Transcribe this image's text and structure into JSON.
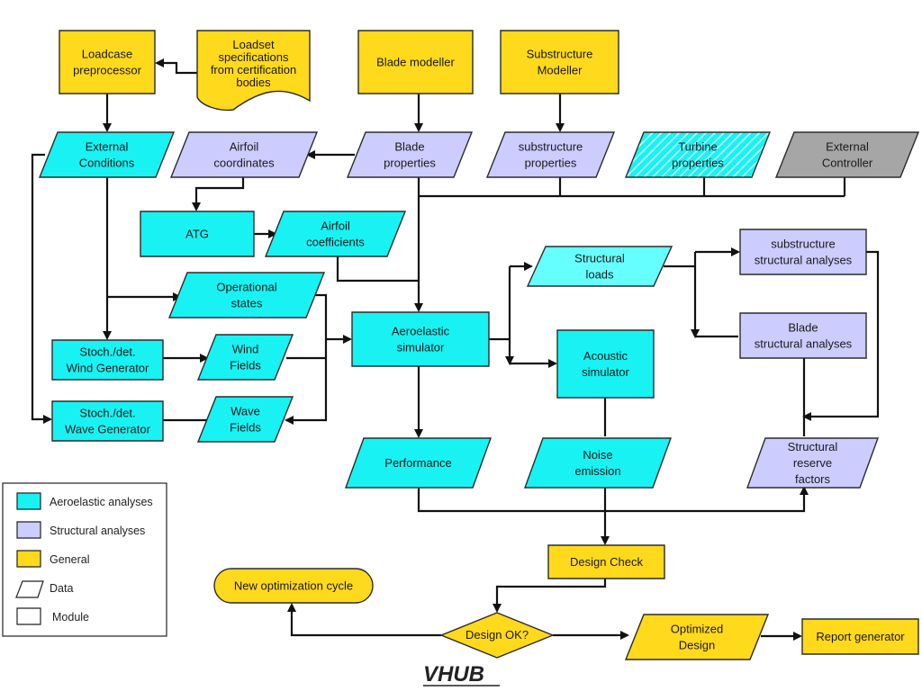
{
  "colors": {
    "aeroelastic": "#18f2f2",
    "structural_loads": "#66ffff",
    "structural": "#ccccff",
    "general": "#ffd91c",
    "external": "#a6a6a6",
    "line": "#111111"
  },
  "nodes": {
    "loadcase": {
      "lines": [
        "Loadcase",
        "preprocessor"
      ],
      "category": "general",
      "shape": "module"
    },
    "loadset": {
      "lines": [
        "Loadset",
        "specifications",
        "from certification",
        "bodies"
      ],
      "category": "general",
      "shape": "document"
    },
    "blade_modeller": {
      "lines": [
        "Blade modeller"
      ],
      "category": "general",
      "shape": "module"
    },
    "substructure_modeller": {
      "lines": [
        "Substructure",
        "Modeller"
      ],
      "category": "general",
      "shape": "module"
    },
    "external_conditions": {
      "lines": [
        "External",
        "Conditions"
      ],
      "category": "aeroelastic",
      "shape": "data"
    },
    "airfoil_coordinates": {
      "lines": [
        "Airfoil",
        "coordinates"
      ],
      "category": "structural",
      "shape": "data"
    },
    "blade_properties": {
      "lines": [
        "Blade",
        "properties"
      ],
      "category": "structural",
      "shape": "data"
    },
    "substructure_properties": {
      "lines": [
        "substructure",
        "properties"
      ],
      "category": "structural",
      "shape": "data"
    },
    "turbine_properties": {
      "lines": [
        "Turbine",
        "properties"
      ],
      "category": "aeroelastic",
      "shape": "data",
      "hatched": true
    },
    "external_controller": {
      "lines": [
        "External",
        "Controller"
      ],
      "category": "external",
      "shape": "data"
    },
    "atg": {
      "lines": [
        "ATG"
      ],
      "category": "aeroelastic",
      "shape": "module"
    },
    "airfoil_coefficients": {
      "lines": [
        "Airfoil",
        "coefficients"
      ],
      "category": "aeroelastic",
      "shape": "data"
    },
    "operational_states": {
      "lines": [
        "Operational",
        "states"
      ],
      "category": "aeroelastic",
      "shape": "data"
    },
    "aeroelastic_simulator": {
      "lines": [
        "Aeroelastic",
        "simulator"
      ],
      "category": "aeroelastic",
      "shape": "module"
    },
    "structural_loads": {
      "lines": [
        "Structural",
        "loads"
      ],
      "category": "structural_loads",
      "shape": "data"
    },
    "substructure_structural": {
      "lines": [
        "substructure",
        "structural analyses"
      ],
      "category": "structural",
      "shape": "module"
    },
    "blade_structural": {
      "lines": [
        "Blade",
        "structural analyses"
      ],
      "category": "structural",
      "shape": "module"
    },
    "acoustic_simulator": {
      "lines": [
        "Acoustic",
        "simulator"
      ],
      "category": "aeroelastic",
      "shape": "module"
    },
    "wind_generator": {
      "lines": [
        "Stoch./det.",
        "Wind Generator"
      ],
      "category": "aeroelastic",
      "shape": "module"
    },
    "wind_fields": {
      "lines": [
        "Wind",
        "Fields"
      ],
      "category": "aeroelastic",
      "shape": "data"
    },
    "wave_generator": {
      "lines": [
        "Stoch./det.",
        "Wave Generator"
      ],
      "category": "aeroelastic",
      "shape": "module"
    },
    "wave_fields": {
      "lines": [
        "Wave",
        "Fields"
      ],
      "category": "aeroelastic",
      "shape": "data"
    },
    "performance": {
      "lines": [
        "Performance"
      ],
      "category": "aeroelastic",
      "shape": "data"
    },
    "noise_emission": {
      "lines": [
        "Noise",
        "emission"
      ],
      "category": "aeroelastic",
      "shape": "data"
    },
    "reserve_factors": {
      "lines": [
        "Structural",
        "reserve",
        "factors"
      ],
      "category": "structural",
      "shape": "data"
    },
    "design_check": {
      "lines": [
        "Design Check"
      ],
      "category": "general",
      "shape": "module"
    },
    "new_optimization_cycle": {
      "lines": [
        "New optimization cycle"
      ],
      "category": "general",
      "shape": "terminal"
    },
    "design_ok": {
      "lines": [
        "Design OK?"
      ],
      "category": "general",
      "shape": "decision"
    },
    "optimized_design": {
      "lines": [
        "Optimized",
        "Design"
      ],
      "category": "general",
      "shape": "data"
    },
    "report_generator": {
      "lines": [
        "Report generator"
      ],
      "category": "general",
      "shape": "module"
    }
  },
  "legend": {
    "items": [
      {
        "label": "Aeroelastic analyses",
        "category": "aeroelastic",
        "shape": "module"
      },
      {
        "label": "Structural analyses",
        "category": "structural",
        "shape": "module"
      },
      {
        "label": "General",
        "category": "general",
        "shape": "module"
      },
      {
        "label": "Data",
        "category": "none",
        "shape": "data"
      },
      {
        "label": "Module",
        "category": "none",
        "shape": "module"
      }
    ]
  },
  "logo": {
    "text": "VHUB"
  }
}
